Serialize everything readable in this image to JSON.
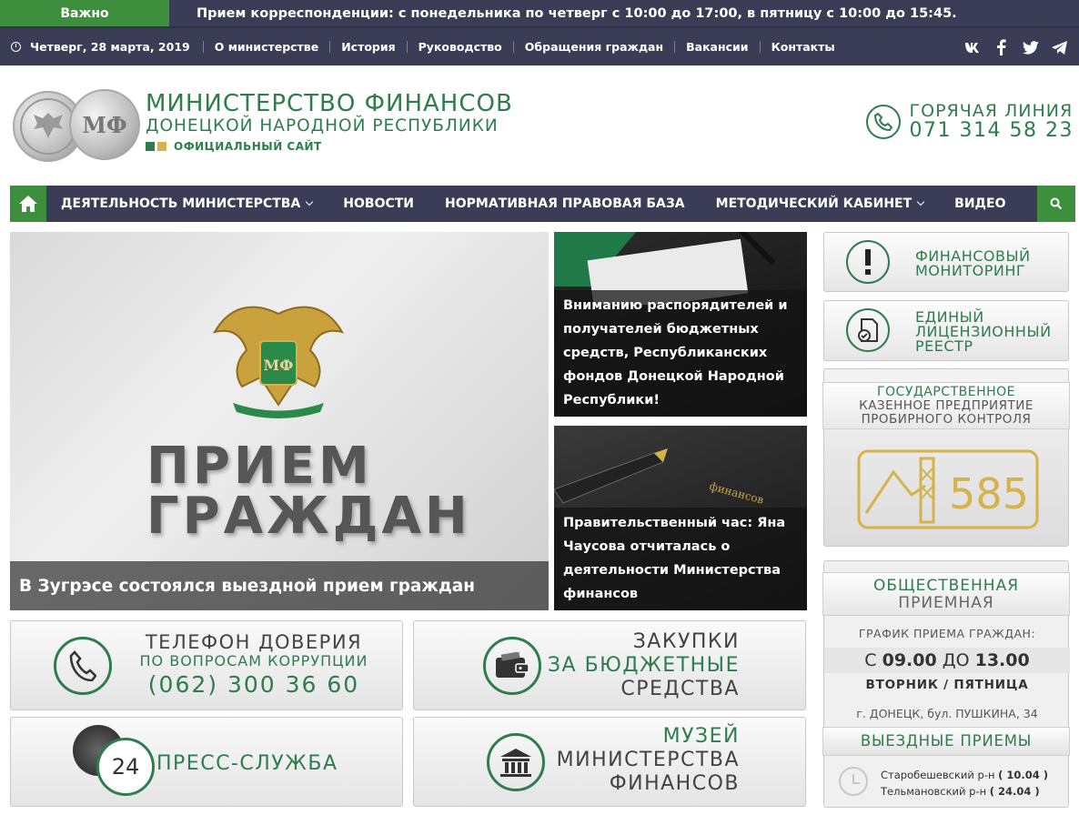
{
  "ticker": {
    "tag": "Важно",
    "text": "Прием корреспонденции: с понедельника по четверг с 10:00 до 17:00, в пятницу с 10:00 до 15:45."
  },
  "topbar": {
    "date": "Четверг, 28 марта, 2019",
    "links": [
      "О министерстве",
      "История",
      "Руководство",
      "Обращения граждан",
      "Вакансии",
      "Контакты"
    ],
    "social": [
      "vk-icon",
      "facebook-icon",
      "twitter-icon",
      "telegram-icon"
    ]
  },
  "header": {
    "logo_letters": "МФ",
    "title": "МИНИСТЕРСТВО ФИНАНСОВ",
    "subtitle": "ДОНЕЦКОЙ НАРОДНОЙ РЕСПУБЛИКИ",
    "tag": "ОФИЦИАЛЬНЫЙ САЙТ",
    "hotline_label": "ГОРЯЧАЯ ЛИНИЯ",
    "hotline_number": "071 314 58 23"
  },
  "nav": {
    "items": [
      "ДЕЯТЕЛЬНОСТЬ МИНИСТЕРСТВА",
      "НОВОСТИ",
      "НОРМАТИВНАЯ ПРАВОВАЯ БАЗА",
      "МЕТОДИЧЕСКИЙ КАБИНЕТ",
      "ВИДЕО"
    ]
  },
  "hero": {
    "emblem_letters": "МФ",
    "word1": "ПРИЕМ",
    "word2": "ГРАЖДАН",
    "caption": "В Зугрэсе состоялся выездной прием граждан"
  },
  "news": [
    {
      "caption": "Вниманию распорядителей и получателей бюджетных средств, Республиканских фондов Донецкой Народной Республики!"
    },
    {
      "caption": "Правительственный час: Яна Чаусова отчиталась о деятельности Министерства финансов",
      "imprint": "финансов"
    }
  ],
  "right": {
    "monitoring": [
      "ФИНАНСОВЫЙ",
      "МОНИТОРИНГ"
    ],
    "registry": [
      "ЕДИНЫЙ",
      "ЛИЦЕНЗИОННЫЙ",
      "РЕЕСТР"
    ],
    "assay": [
      "ГОСУДАРСТВЕННОЕ",
      "КАЗЕННОЕ ПРЕДПРИЯТИЕ",
      "ПРОБИРНОГО КОНТРОЛЯ"
    ],
    "assay_number": "585",
    "reception_title": [
      "ОБЩЕСТВЕННАЯ",
      "ПРИЕМНАЯ"
    ],
    "schedule_label": "ГРАФИК ПРИЕМА ГРАЖДАН:",
    "schedule_from": "С",
    "schedule_start": "09.00",
    "schedule_to": "ДО",
    "schedule_end": "13.00",
    "schedule_days": "ВТОРНИК / ПЯТНИЦА",
    "address": "г. ДОНЕЦК, бул. ПУШКИНА, 34",
    "field_title": "ВЫЕЗДНЫЕ ПРИЕМЫ",
    "field_items": [
      {
        "district": "Старобешевский р-н",
        "date": "( 10.04 )"
      },
      {
        "district": "Тельмановский р-н",
        "date": "( 24.04 )"
      }
    ]
  },
  "boxes": {
    "trust": {
      "line1": "ТЕЛЕФОН ДОВЕРИЯ",
      "line2": "ПО ВОПРОСАМ КОРРУПЦИИ",
      "phone": "(062) 300 36 60"
    },
    "procurement": {
      "line1": "ЗАКУПКИ",
      "line2": "ЗА БЮДЖЕТНЫЕ",
      "line3": "СРЕДСТВА"
    },
    "press": {
      "badge": "24",
      "label": "ПРЕСС-СЛУЖБА"
    },
    "museum": {
      "line1": "МУЗЕЙ",
      "line2": "МИНИСТЕРСТВА",
      "line3": "ФИНАНСОВ"
    }
  },
  "colors": {
    "navy": "#3a3d55",
    "green": "#3d8f3d",
    "brand_green": "#2e7d4c",
    "gold": "#d4b24c"
  }
}
